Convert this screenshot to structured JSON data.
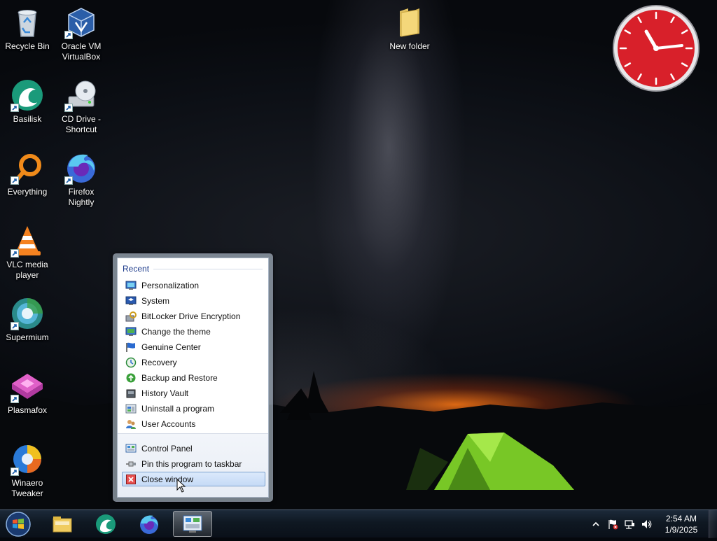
{
  "desktop": {
    "icons": [
      {
        "label_1": "Recycle Bin",
        "label_2": "",
        "icon": "recycle-bin-icon"
      },
      {
        "label_1": "Oracle VM",
        "label_2": "VirtualBox",
        "icon": "virtualbox-icon"
      },
      {
        "label_1": "Basilisk",
        "label_2": "",
        "icon": "basilisk-icon"
      },
      {
        "label_1": "CD Drive -",
        "label_2": "Shortcut",
        "icon": "cd-drive-icon"
      },
      {
        "label_1": "Everything",
        "label_2": "",
        "icon": "everything-icon"
      },
      {
        "label_1": "Firefox",
        "label_2": "Nightly",
        "icon": "firefox-nightly-icon"
      },
      {
        "label_1": "VLC media",
        "label_2": "player",
        "icon": "vlc-icon"
      },
      {
        "label_1": "Supermium",
        "label_2": "",
        "icon": "supermium-icon"
      },
      {
        "label_1": "Plasmafox",
        "label_2": "",
        "icon": "plasmafox-icon"
      },
      {
        "label_1": "Winaero",
        "label_2": "Tweaker",
        "icon": "winaero-tweaker-icon"
      },
      {
        "label_1": "New folder",
        "label_2": "",
        "icon": "folder-icon"
      }
    ]
  },
  "jumplist": {
    "recent_header": "Recent",
    "recent_items": [
      {
        "label": "Personalization",
        "icon": "personalization-icon"
      },
      {
        "label": "System",
        "icon": "system-icon"
      },
      {
        "label": "BitLocker Drive Encryption",
        "icon": "bitlocker-icon"
      },
      {
        "label": "Change the theme",
        "icon": "theme-icon"
      },
      {
        "label": "Genuine Center",
        "icon": "genuine-flag-icon"
      },
      {
        "label": "Recovery",
        "icon": "recovery-icon"
      },
      {
        "label": "Backup and Restore",
        "icon": "backup-icon"
      },
      {
        "label": "History Vault",
        "icon": "history-vault-icon"
      },
      {
        "label": "Uninstall a program",
        "icon": "uninstall-icon"
      },
      {
        "label": "User Accounts",
        "icon": "user-accounts-icon"
      }
    ],
    "tasks": [
      {
        "label": "Control Panel",
        "icon": "control-panel-icon"
      },
      {
        "label": "Pin this program to taskbar",
        "icon": "pin-icon"
      },
      {
        "label": "Close window",
        "icon": "close-window-icon"
      }
    ]
  },
  "taskbar": {
    "pinned": [
      {
        "name": "file-explorer",
        "icon": "folder-icon"
      },
      {
        "name": "basilisk",
        "icon": "basilisk-icon"
      },
      {
        "name": "firefox",
        "icon": "firefox-icon"
      },
      {
        "name": "control-panel",
        "icon": "control-panel-icon",
        "active": true
      }
    ],
    "clock": {
      "time": "2:54 AM",
      "date": "1/9/2025"
    }
  },
  "colors": {
    "accent": "#1e3c8c",
    "clock_face": "#d8202a",
    "tent": "#7fd12a"
  }
}
